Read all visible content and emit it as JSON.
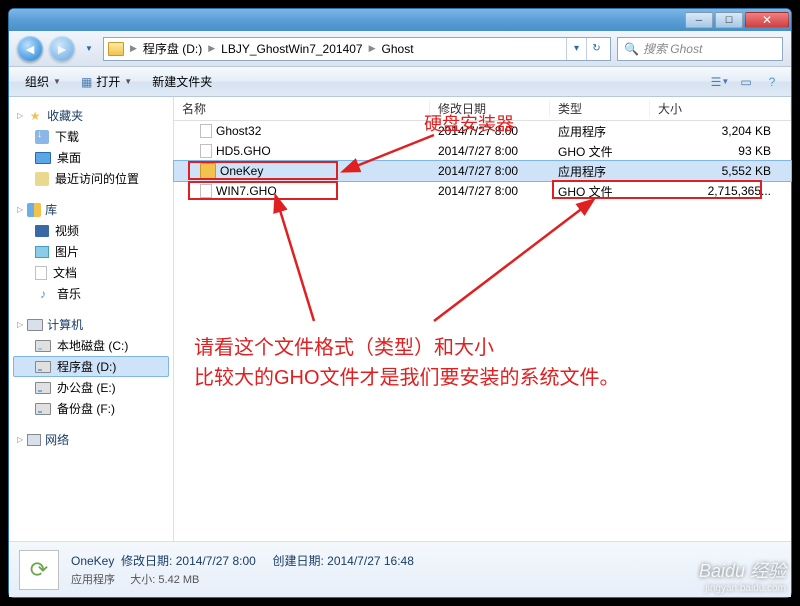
{
  "titlebar": {},
  "nav": {
    "crumb1": "程序盘 (D:)",
    "crumb2": "LBJY_GhostWin7_201407",
    "crumb3": "Ghost",
    "search_placeholder": "搜索 Ghost"
  },
  "toolbar": {
    "organize": "组织",
    "open": "打开",
    "newfolder": "新建文件夹"
  },
  "sidebar": {
    "favorites": "收藏夹",
    "downloads": "下载",
    "desktop": "桌面",
    "recent": "最近访问的位置",
    "library": "库",
    "video": "视频",
    "pictures": "图片",
    "docs": "文档",
    "music": "音乐",
    "computer": "计算机",
    "cdrive": "本地磁盘 (C:)",
    "ddrive": "程序盘 (D:)",
    "edrive": "办公盘 (E:)",
    "fdrive": "备份盘 (F:)",
    "network": "网络"
  },
  "columns": {
    "name": "名称",
    "date": "修改日期",
    "type": "类型",
    "size": "大小"
  },
  "files": [
    {
      "name": "Ghost32",
      "date": "2014/7/27 8:00",
      "type": "应用程序",
      "size": "3,204 KB"
    },
    {
      "name": "HD5.GHO",
      "date": "2014/7/27 8:00",
      "type": "GHO 文件",
      "size": "93 KB"
    },
    {
      "name": "OneKey",
      "date": "2014/7/27 8:00",
      "type": "应用程序",
      "size": "5,552 KB"
    },
    {
      "name": "WIN7.GHO",
      "date": "2014/7/27 8:00",
      "type": "GHO 文件",
      "size": "2,715,365..."
    }
  ],
  "details": {
    "title": "OneKey",
    "moddate_label": "修改日期:",
    "moddate": "2014/7/27 8:00",
    "createdate_label": "创建日期:",
    "createdate": "2014/7/27 16:48",
    "type": "应用程序",
    "size_label": "大小:",
    "size": "5.42 MB"
  },
  "annotations": {
    "label1": "硬盘安装器",
    "label2_line1": "请看这个文件格式（类型）和大小",
    "label2_line2": "比较大的GHO文件才是我们要安装的系统文件。"
  },
  "watermark": {
    "brand": "Baidu 经验",
    "url": "jingyan.baidu.com"
  }
}
